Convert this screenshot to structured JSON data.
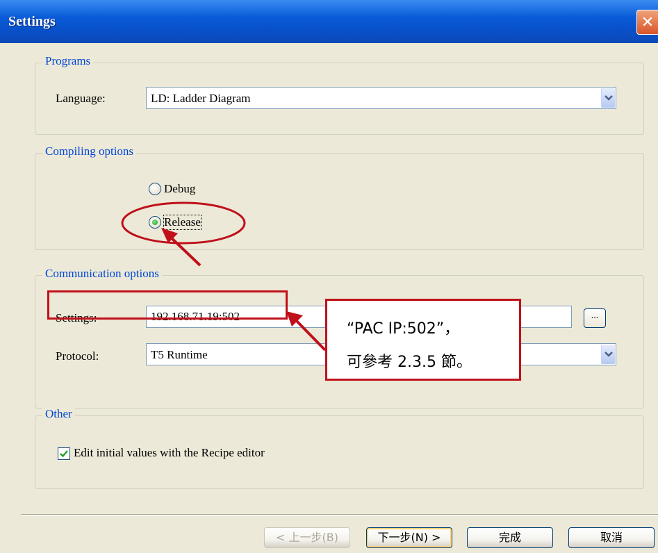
{
  "window": {
    "title": "Settings"
  },
  "programs": {
    "legend": "Programs",
    "language_label": "Language:",
    "language_value": "LD: Ladder Diagram"
  },
  "compiling": {
    "legend": "Compiling options",
    "debug_label": "Debug",
    "release_label": "Release",
    "selected": "Release"
  },
  "communication": {
    "legend": "Communication options",
    "settings_label": "Settings:",
    "settings_value": "192.168.71.19:502",
    "browse_label": "...",
    "protocol_label": "Protocol:",
    "protocol_value": "T5 Runtime"
  },
  "other": {
    "legend": "Other",
    "recipe_label": "Edit initial values with the Recipe editor",
    "recipe_checked": true
  },
  "buttons": {
    "back": "< 上一步(B)",
    "next": "下一步(N) >",
    "finish": "完成",
    "cancel": "取消"
  },
  "annotation": {
    "line1": "“PAC IP:502”，",
    "line2": "可參考 2.3.5 節。",
    "color": "#c0101a"
  }
}
